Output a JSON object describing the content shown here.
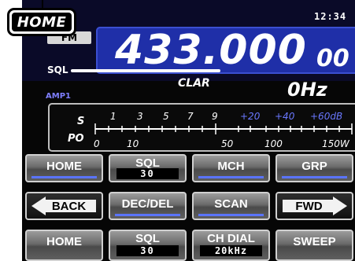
{
  "callout": {
    "label": "HOME"
  },
  "status": {
    "clock": "12:34",
    "mode": "FM"
  },
  "frequency": {
    "main": "433.000",
    "sub": "00"
  },
  "sql": {
    "label": "SQL"
  },
  "clar": {
    "label": "CLAR",
    "value": "0Hz"
  },
  "amp": {
    "label": "AMP1"
  },
  "meter": {
    "s_label": "S",
    "po_label": "PO",
    "s_scale": [
      "1",
      "3",
      "5",
      "7",
      "9",
      "+20",
      "+40",
      "+60dB"
    ],
    "po_scale": [
      "0",
      "10",
      "50",
      "100",
      "150W"
    ]
  },
  "buttons": [
    {
      "id": "home",
      "label": "HOME"
    },
    {
      "id": "sql",
      "label": "SQL",
      "value": "30"
    },
    {
      "id": "mch",
      "label": "MCH"
    },
    {
      "id": "grp",
      "label": "GRP"
    },
    {
      "id": "back",
      "label": "BACK"
    },
    {
      "id": "dec-del",
      "label": "DEC/DEL"
    },
    {
      "id": "scan",
      "label": "SCAN"
    },
    {
      "id": "fwd",
      "label": "FWD"
    },
    {
      "id": "home2",
      "label": "HOME"
    },
    {
      "id": "sql2",
      "label": "SQL",
      "value": "30"
    },
    {
      "id": "ch-dial",
      "label": "CH DIAL",
      "value": "20kHz"
    },
    {
      "id": "sweep",
      "label": "SWEEP"
    }
  ],
  "colors": {
    "freq_bg": "#1f2fa8",
    "accent_blue": "#5a74ff",
    "meter_plus": "#6a78ff"
  }
}
